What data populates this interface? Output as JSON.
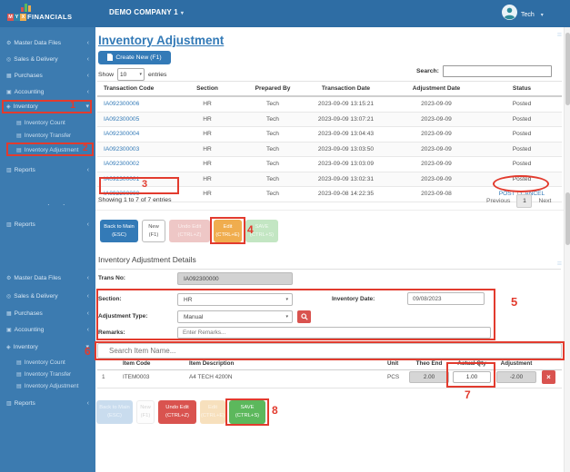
{
  "topbar": {
    "logo": {
      "letters": [
        "M",
        "Y",
        "X"
      ],
      "name": "FINANCIALS"
    },
    "company": "DEMO COMPANY 1",
    "user": "Tech"
  },
  "icons": {
    "caret_down": "▾",
    "chevron_collapsed": "‹",
    "hamburger": "≡",
    "dots": "· ·",
    "gear": "⚙",
    "tag": "◎",
    "cart": "▦",
    "ledger": "▣",
    "inventory": "◈",
    "list": "▤",
    "report": "▥",
    "delete_x": "×",
    "status_separator": "|"
  },
  "sidebar": {
    "items": [
      {
        "label": "Master Data Files"
      },
      {
        "label": "Sales & Delivery"
      },
      {
        "label": "Purchases"
      },
      {
        "label": "Accounting"
      },
      {
        "label": "Inventory"
      },
      {
        "label": "Inventory Count"
      },
      {
        "label": "Inventory Transfer"
      },
      {
        "label": "Inventory Adjustment"
      },
      {
        "label": "Reports"
      }
    ]
  },
  "list_view": {
    "title": "Inventory Adjustment",
    "create_button": "Create New (F1)",
    "show_label": "Show",
    "page_size": "10",
    "entries_label": "entries",
    "search_label": "Search:",
    "table": {
      "headers": [
        "Transaction Code",
        "Section",
        "Prepared By",
        "Transaction Date",
        "Adjustment Date",
        "Status"
      ],
      "rows": [
        {
          "code": "IA092300006",
          "section": "HR",
          "prepared_by": "Tech",
          "transaction_date": "2023-09-09 13:15:21",
          "adjustment_date": "2023-09-09",
          "status": "Posted"
        },
        {
          "code": "IA092300005",
          "section": "HR",
          "prepared_by": "Tech",
          "transaction_date": "2023-09-09 13:07:21",
          "adjustment_date": "2023-09-09",
          "status": "Posted"
        },
        {
          "code": "IA092300004",
          "section": "HR",
          "prepared_by": "Tech",
          "transaction_date": "2023-09-09 13:04:43",
          "adjustment_date": "2023-09-09",
          "status": "Posted"
        },
        {
          "code": "IA092300003",
          "section": "HR",
          "prepared_by": "Tech",
          "transaction_date": "2023-09-09 13:03:50",
          "adjustment_date": "2023-09-09",
          "status": "Posted"
        },
        {
          "code": "IA092300002",
          "section": "HR",
          "prepared_by": "Tech",
          "transaction_date": "2023-09-09 13:03:09",
          "adjustment_date": "2023-09-09",
          "status": "Posted"
        },
        {
          "code": "IA092300001",
          "section": "HR",
          "prepared_by": "Tech",
          "transaction_date": "2023-09-09 13:02:31",
          "adjustment_date": "2023-09-09",
          "status": "Posted"
        },
        {
          "code": "IA092300000",
          "section": "HR",
          "prepared_by": "Tech",
          "transaction_date": "2023-09-08 14:22:35",
          "adjustment_date": "2023-09-08",
          "status_post": "POST",
          "status_cancel": "CANCEL"
        }
      ]
    },
    "showing_text": "Showing 1 to 7 of 7 entries",
    "pagination": {
      "previous": "Previous",
      "current": "1",
      "next": "Next"
    }
  },
  "detail_view": {
    "buttons": {
      "back": "Back to Main\n(ESC)",
      "new": "New\n(F1)",
      "undo": "Undo Edit\n(CTRL+Z)",
      "edit": "Edit\n(CTRL+E)",
      "save": "SAVE\n(CTRL+S)"
    },
    "section_title": "Inventory Adjustment Details",
    "form": {
      "trans_no_label": "Trans No:",
      "trans_no_value": "IA092300000",
      "section_label": "Section:",
      "section_value": "HR",
      "inventory_date_label": "Inventory Date:",
      "inventory_date_value": "09/08/2023",
      "adjustment_type_label": "Adjustment Type:",
      "adjustment_type_value": "Manual",
      "remarks_label": "Remarks:",
      "remarks_placeholder": "Enter Remarks..."
    },
    "item_search_placeholder": "Search Item Name...",
    "items_table": {
      "headers": {
        "item_code": "Item Code",
        "item_description": "Item Description",
        "unit": "Unit",
        "theo_end": "Theo End",
        "actual_qty": "Actual Qty",
        "adjustment": "Adjustment"
      },
      "rows": [
        {
          "num": "1",
          "item_code": "ITEM0003",
          "item_description": "A4 TECH 4200N",
          "unit": "PCS",
          "theo_end": "2.00",
          "actual_qty": "1.00",
          "adjustment": "-2.00"
        }
      ]
    }
  },
  "annotations": {
    "n1": "1",
    "n2": "2",
    "n3": "3",
    "n4": "4",
    "n5": "5",
    "n6": "6",
    "n7": "7",
    "n8": "8"
  },
  "colors": {
    "topbar": "#2e6da4",
    "sidebar": "#3c7bb0",
    "link_blue": "#337ab7",
    "button_orange": "#f0ad4e",
    "button_red": "#d9534f",
    "button_green": "#5cb85c",
    "annotation_red": "#e23b2e"
  }
}
